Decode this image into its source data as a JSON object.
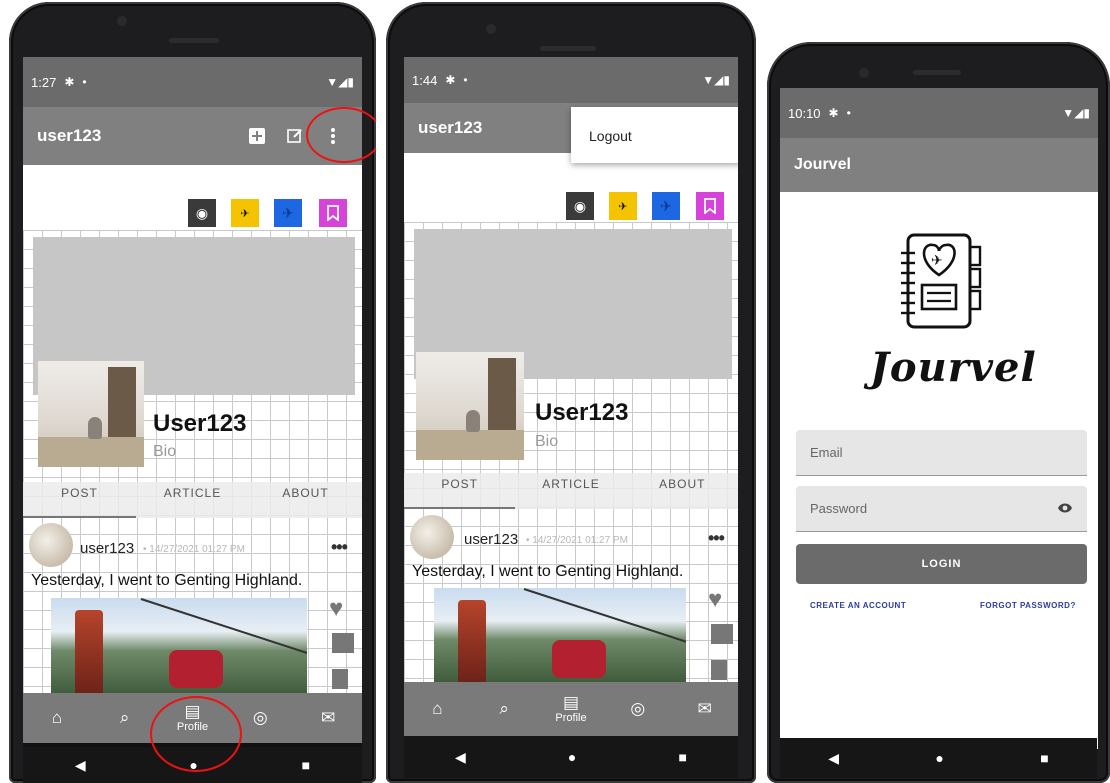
{
  "phone1": {
    "status_time": "1:27",
    "username": "user123",
    "display_name": "User123",
    "bio": "Bio",
    "tabs": [
      "POST",
      "ARTICLE",
      "ABOUT"
    ],
    "post": {
      "user": "user123",
      "time": "14/27/2021 01:27 PM",
      "text": "Yesterday, I went to Genting Highland."
    },
    "nav": {
      "profile_label": "Profile"
    }
  },
  "phone2": {
    "status_time": "1:44",
    "username": "user123",
    "menu_logout": "Logout",
    "display_name": "User123",
    "bio": "Bio",
    "tabs": [
      "POST",
      "ARTICLE",
      "ABOUT"
    ],
    "post": {
      "user": "user123",
      "time": "14/27/2021 01:27 PM",
      "text": "Yesterday, I went to Genting Highland."
    },
    "nav": {
      "profile_label": "Profile"
    }
  },
  "phone3": {
    "status_time": "10:10",
    "app_title": "Jourvel",
    "wordmark": "Jourvel",
    "email_placeholder": "Email",
    "password_placeholder": "Password",
    "login_label": "LOGIN",
    "create_account": "CREATE AN ACCOUNT",
    "forgot_password": "FORGOT PASSWORD?"
  },
  "colors": {
    "appbar": "#808080",
    "annotation": "#e11111",
    "chip_world": "#3a3a3a",
    "chip_map": "#f5c400",
    "chip_plane": "#1d67e3",
    "chip_bookmark": "#d543d8",
    "link": "#2c3ea0"
  }
}
